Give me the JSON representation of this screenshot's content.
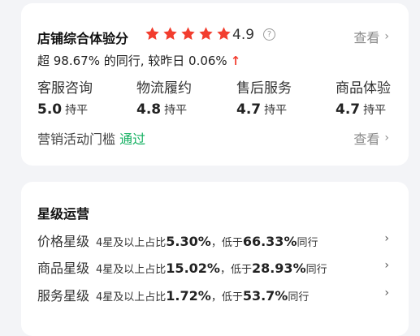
{
  "score_card": {
    "title": "店铺综合体验分",
    "stars_count": 5,
    "score": "4.9",
    "help_glyph": "?",
    "view_label": "查看",
    "chevron": "›",
    "compare_prefix": "超 98.67% 的同行, 较昨日 0.06%",
    "compare_arrow": "↑",
    "metrics": [
      {
        "label": "客服咨询",
        "value": "5.0",
        "tag": "持平"
      },
      {
        "label": "物流履约",
        "value": "4.8",
        "tag": "持平"
      },
      {
        "label": "售后服务",
        "value": "4.7",
        "tag": "持平"
      },
      {
        "label": "商品体验",
        "value": "4.7",
        "tag": "持平"
      }
    ],
    "threshold_label": "营销活动门槛",
    "threshold_status": "通过",
    "threshold_view": "查看",
    "colors": {
      "star": "#f23d2e",
      "pass": "#14b061",
      "up_arrow": "#f23d2e"
    }
  },
  "star_card": {
    "title": "星级运营",
    "rows": [
      {
        "label": "价格星级",
        "s1": "4星及以上占比",
        "b1": "5.30%",
        "s2": "，低于",
        "b2": "66.33%",
        "s3": "同行"
      },
      {
        "label": "商品星级",
        "s1": "4星及以上占比",
        "b1": "15.02%",
        "s2": "，低于",
        "b2": "28.93%",
        "s3": "同行"
      },
      {
        "label": "服务星级",
        "s1": "4星及以上占比",
        "b1": "1.72%",
        "s2": "，低于",
        "b2": "53.7%",
        "s3": "同行"
      }
    ],
    "chevron": "›"
  }
}
